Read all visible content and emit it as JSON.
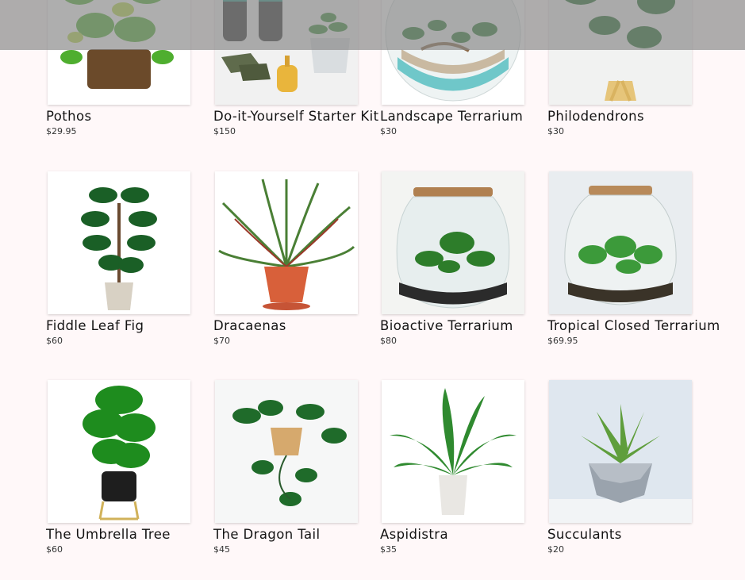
{
  "products": [
    {
      "name": "Pothos",
      "price": "$29.95",
      "icon": "pothos-plant"
    },
    {
      "name": "Do-it-Yourself Starter Kit",
      "price": "$150",
      "icon": "starter-kit"
    },
    {
      "name": "Landscape Terrarium",
      "price": "$30",
      "icon": "bowl-terrarium"
    },
    {
      "name": "Philodendrons",
      "price": "$30",
      "icon": "philodendron-plant"
    },
    {
      "name": "Fiddle Leaf Fig",
      "price": "$60",
      "icon": "fiddle-leaf-fig-plant"
    },
    {
      "name": "Dracaenas",
      "price": "$70",
      "icon": "dracaena-plant"
    },
    {
      "name": "Bioactive Terrarium",
      "price": "$80",
      "icon": "jar-terrarium"
    },
    {
      "name": "Tropical Closed Terrarium",
      "price": "$69.95",
      "icon": "closed-terrarium"
    },
    {
      "name": "The Umbrella Tree",
      "price": "$60",
      "icon": "umbrella-tree-plant"
    },
    {
      "name": "The Dragon Tail",
      "price": "$45",
      "icon": "dragon-tail-plant"
    },
    {
      "name": "Aspidistra",
      "price": "$35",
      "icon": "aspidistra-plant"
    },
    {
      "name": "Succulants",
      "price": "$20",
      "icon": "succulent-plant"
    }
  ],
  "colors": {
    "page_background": "#fff8f9",
    "overlay": "#878787",
    "leaf_dark": "#1f6b2a",
    "leaf_light": "#3fa23a"
  }
}
